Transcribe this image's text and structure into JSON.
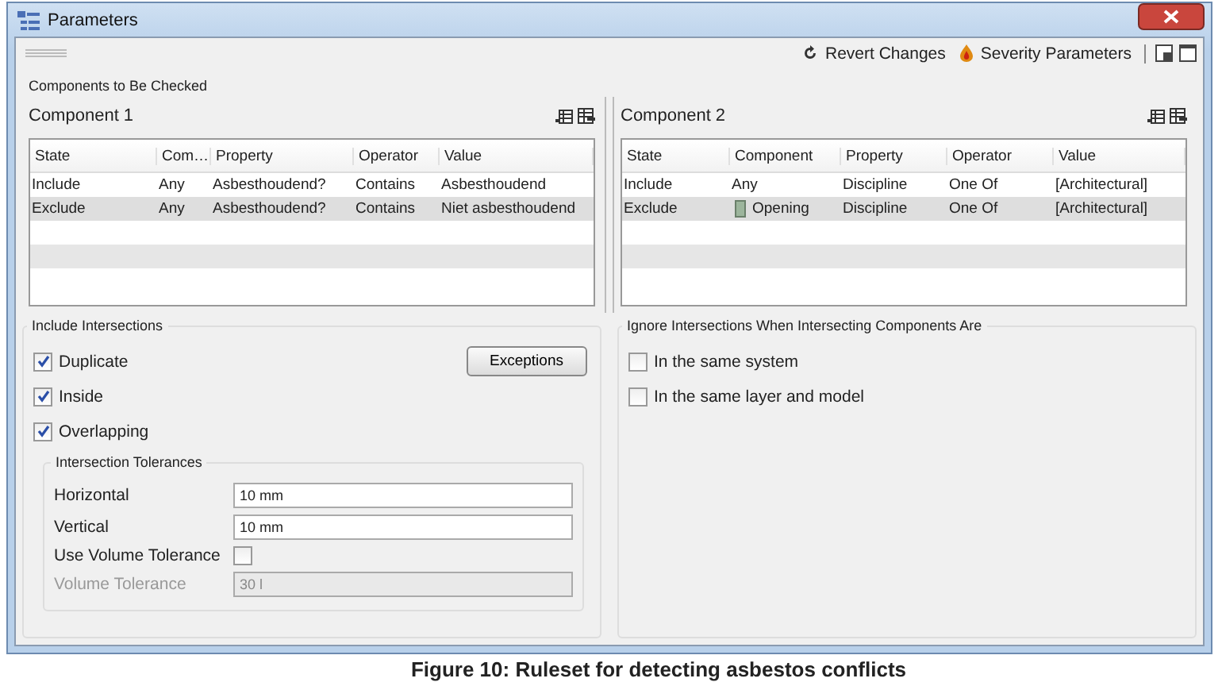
{
  "window": {
    "title": "Parameters"
  },
  "toolbar": {
    "actions": [
      {
        "label": "Revert Changes",
        "kind": "revert"
      },
      {
        "label": "Severity Parameters",
        "kind": "severity"
      }
    ]
  },
  "components_section": {
    "title": "Components to Be Checked"
  },
  "panels": [
    {
      "title": "Component 1",
      "columns": [
        "State",
        "Com…",
        "Property",
        "Operator",
        "Value"
      ],
      "rows": [
        {
          "cells": [
            "Include",
            "Any",
            "Asbesthoudend?",
            "Contains",
            "Asbesthoudend"
          ],
          "selected": false,
          "component_icon": false
        },
        {
          "cells": [
            "Exclude",
            "Any",
            "Asbesthoudend?",
            "Contains",
            "Niet asbesthoudend"
          ],
          "selected": true,
          "component_icon": false
        }
      ]
    },
    {
      "title": "Component 2",
      "columns": [
        "State",
        "Component",
        "Property",
        "Operator",
        "Value"
      ],
      "rows": [
        {
          "cells": [
            "Include",
            "Any",
            "Discipline",
            "One Of",
            "[Architectural]"
          ],
          "selected": false,
          "component_icon": false
        },
        {
          "cells": [
            "Exclude",
            "Opening",
            "Discipline",
            "One Of",
            "[Architectural]"
          ],
          "selected": true,
          "component_icon": true
        }
      ]
    }
  ],
  "include_intersections": {
    "title": "Include Intersections",
    "button": "Exceptions",
    "options": [
      {
        "label": "Duplicate",
        "checked": true
      },
      {
        "label": "Inside",
        "checked": true
      },
      {
        "label": "Overlapping",
        "checked": true
      }
    ],
    "tolerances": {
      "title": "Intersection Tolerances",
      "fields": [
        {
          "kind": "text",
          "label": "Horizontal",
          "value": "10 mm",
          "disabled": false
        },
        {
          "kind": "text",
          "label": "Vertical",
          "value": "10 mm",
          "disabled": false
        },
        {
          "kind": "checkbox",
          "label": "Use Volume Tolerance",
          "checked": false,
          "disabled": false
        },
        {
          "kind": "text",
          "label": "Volume Tolerance",
          "value": "30 l",
          "disabled": true
        }
      ]
    }
  },
  "ignore_intersections": {
    "title": "Ignore Intersections When Intersecting Components Are",
    "options": [
      {
        "label": "In the same system",
        "checked": false
      },
      {
        "label": "In the same layer and model",
        "checked": false
      }
    ]
  },
  "caption": "Figure 10: Ruleset for detecting asbestos conflicts"
}
